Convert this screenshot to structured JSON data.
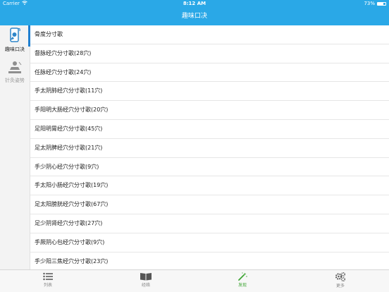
{
  "status": {
    "carrier": "Carrier",
    "time": "8:12 AM",
    "battery": "73%",
    "battery_level": 0.73
  },
  "nav": {
    "title": "趣味口决"
  },
  "sidebar": {
    "items": [
      {
        "label": "趣味口决",
        "icon": "phone-acupoint-icon",
        "active": true
      },
      {
        "label": "针灸姿势",
        "icon": "acupuncture-posture-icon",
        "active": false
      }
    ]
  },
  "list": {
    "items": [
      "骨度分寸歌",
      "督脉经穴分寸歌(28穴)",
      "任脉经穴分寸歌(24穴)",
      "手太阴肺经穴分寸歌(11穴)",
      "手阳明大肠经穴分寸歌(20穴)",
      "足阳明胃经穴分寸歌(45穴)",
      "足太阴脾经穴分寸歌(21穴)",
      "手少阴心经穴分寸歌(9穴)",
      "手太阳小肠经穴分寸歌(19穴)",
      "足太阳膀胱经穴分寸歌(67穴)",
      "足少阴肾经穴分寸歌(27穴)",
      "手厥阴心包经穴分寸歌(9穴)",
      "手少阳三焦经穴分寸歌(23穴)"
    ]
  },
  "tabs": [
    {
      "label": "列表",
      "icon": "list-icon"
    },
    {
      "label": "经络",
      "icon": "book-icon"
    },
    {
      "label": "发现",
      "icon": "magic-wand-icon",
      "active": true
    },
    {
      "label": "更多",
      "icon": "gears-icon"
    }
  ],
  "colors": {
    "accent": "#2aa8e7",
    "active_tab": "#3fa535",
    "inactive": "#8a8a8a"
  }
}
